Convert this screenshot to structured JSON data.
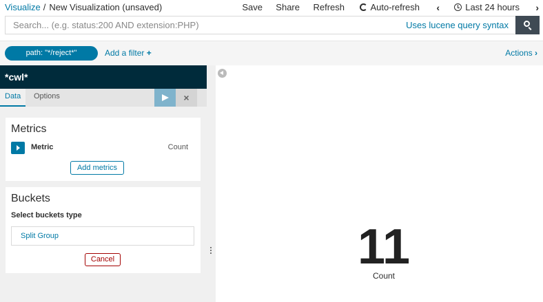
{
  "header": {
    "breadcrumb_link": "Visualize",
    "breadcrumb_sep": "/",
    "breadcrumb_current": "New Visualization (unsaved)",
    "save": "Save",
    "share": "Share",
    "refresh": "Refresh",
    "auto_refresh": "Auto-refresh",
    "time_range": "Last 24 hours"
  },
  "search": {
    "placeholder": "Search... (e.g. status:200 AND extension:PHP)",
    "syntax_link": "Uses lucene query syntax"
  },
  "filters": {
    "pill": "path: \"*/reject*\"",
    "add_filter": "Add a filter",
    "actions": "Actions"
  },
  "editor": {
    "index_pattern": "*cwl*",
    "tabs": [
      "Data",
      "Options"
    ],
    "metrics_title": "Metrics",
    "metric_label": "Metric",
    "metric_agg": "Count",
    "add_metrics": "Add metrics",
    "buckets_title": "Buckets",
    "select_buckets_type": "Select buckets type",
    "split_group": "Split Group",
    "cancel": "Cancel"
  },
  "visualization": {
    "value": "11",
    "label": "Count"
  }
}
